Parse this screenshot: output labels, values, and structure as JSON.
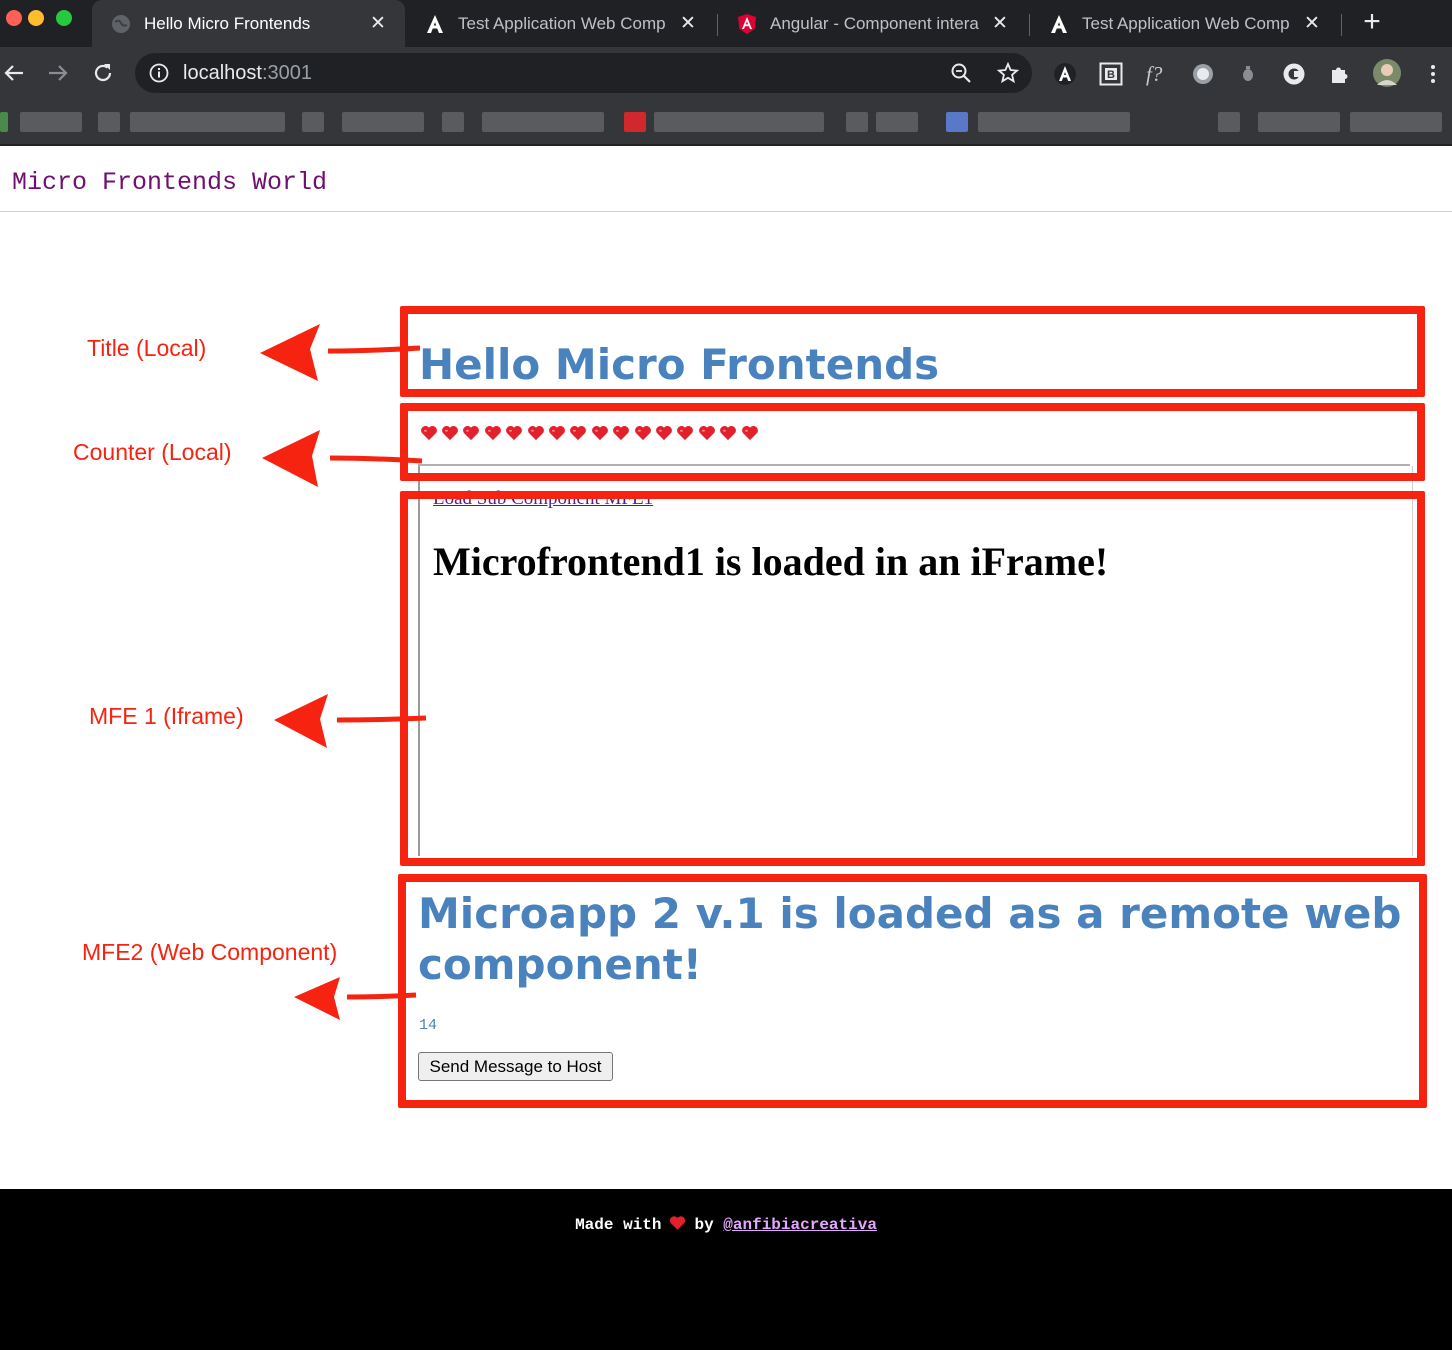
{
  "browser": {
    "tabs": [
      {
        "title": "Hello Micro Frontends",
        "icon": "globe-icon",
        "active": true
      },
      {
        "title": "Test Application Web Comp",
        "icon": "angular-a-icon",
        "active": false
      },
      {
        "title": "Angular - Component intera",
        "icon": "angular-shield-icon",
        "active": false
      },
      {
        "title": "Test Application Web Comp",
        "icon": "angular-a-icon",
        "active": false
      }
    ],
    "tab_close": "✕",
    "new_tab": "+",
    "url_host": "localhost",
    "url_port": ":3001",
    "extension_icons": [
      "zoom-icon",
      "bookmark-star-icon",
      "a-extension-icon",
      "b-extension-icon",
      "f-extension-icon",
      "circle-extension-icon",
      "bulb-extension-icon",
      "c-extension-icon",
      "puzzle-icon",
      "profile-avatar-icon",
      "menu-dots-icon"
    ]
  },
  "colors": {
    "annotation_red": "#f5230f",
    "title_blue": "#4a82be",
    "header_purple": "#6f0f6f",
    "heart_red": "#e3202b"
  },
  "page": {
    "header_title": "Micro Frontends World",
    "hello_title": "Hello Micro Frontends",
    "heart_count": 16,
    "iframe_link": "Load Sub Component MFE1",
    "iframe_title": "Microfrontend1 is loaded in an iFrame!",
    "mfe2_title": "Microapp 2 v.1 is loaded as a remote web component!",
    "mfe2_count": "14",
    "mfe2_button": "Send Message to Host"
  },
  "annotations": {
    "title": "Title (Local)",
    "counter": "Counter (Local)",
    "mfe1": "MFE 1 (Iframe)",
    "mfe2": "MFE2 (Web Component)"
  },
  "footer": {
    "made_with": "Made with",
    "by": "by",
    "link": "@anfibiacreativa"
  }
}
